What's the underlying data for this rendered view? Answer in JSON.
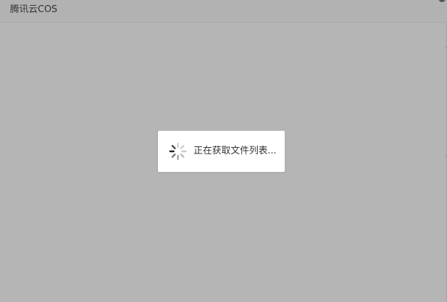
{
  "window": {
    "title": "腾讯云COS"
  },
  "dialog": {
    "loading_text": "正在获取文件列表..."
  },
  "colors": {
    "overlay": "#b5b5b5",
    "dialog_bg": "#ffffff",
    "text": "#333333",
    "spinner_dark": "#222222",
    "spinner_light": "#cfcfcf"
  }
}
